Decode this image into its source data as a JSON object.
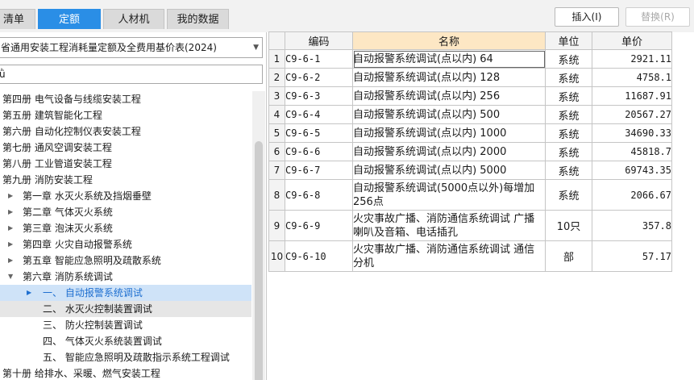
{
  "tabs": [
    {
      "label": "清单",
      "active": false
    },
    {
      "label": "定额",
      "active": true
    },
    {
      "label": "人材机",
      "active": false
    },
    {
      "label": "我的数据",
      "active": false
    }
  ],
  "toolbar": {
    "insert_label": "插入(I)",
    "replace_label": "替换(R)"
  },
  "library": {
    "selected": "省通用安装工程消耗量定额及全费用基价表(2024)"
  },
  "search": {
    "value": "ǜ"
  },
  "tree": [
    {
      "label": "第四册 电气设备与线缆安装工程",
      "level": 0
    },
    {
      "label": "第五册 建筑智能化工程",
      "level": 0
    },
    {
      "label": "第六册 自动化控制仪表安装工程",
      "level": 0
    },
    {
      "label": "第七册 通风空调安装工程",
      "level": 0
    },
    {
      "label": "第八册 工业管道安装工程",
      "level": 0
    },
    {
      "label": "第九册 消防安装工程",
      "level": 0
    },
    {
      "label": "第一章 水灭火系统及挡烟垂壁",
      "level": 1,
      "arrow": "collapsed"
    },
    {
      "label": "第二章 气体灭火系统",
      "level": 1,
      "arrow": "collapsed"
    },
    {
      "label": "第三章 泡沫灭火系统",
      "level": 1,
      "arrow": "collapsed"
    },
    {
      "label": "第四章 火灾自动报警系统",
      "level": 1,
      "arrow": "collapsed"
    },
    {
      "label": "第五章 智能应急照明及疏散系统",
      "level": 1,
      "arrow": "collapsed"
    },
    {
      "label": "第六章 消防系统调试",
      "level": 1,
      "arrow": "expanded"
    },
    {
      "label": "一、 自动报警系统调试",
      "level": 2,
      "arrow": "collapsed",
      "state": "selected"
    },
    {
      "label": "二、 水灭火控制装置调试",
      "level": 2,
      "state": "hover"
    },
    {
      "label": "三、 防火控制装置调试",
      "level": 2
    },
    {
      "label": "四、 气体灭火系统装置调试",
      "level": 2
    },
    {
      "label": "五、 智能应急照明及疏散指示系统工程调试",
      "level": 2
    },
    {
      "label": "第十册 给排水、采暖、燃气安装工程",
      "level": 0
    }
  ],
  "table": {
    "columns": [
      "",
      "编码",
      "名称",
      "单位",
      "单价"
    ],
    "rows": [
      {
        "idx": "1",
        "code": "C9-6-1",
        "name": "自动报警系统调试(点以内) 64",
        "unit": "系统",
        "price": "2921.11"
      },
      {
        "idx": "2",
        "code": "C9-6-2",
        "name": "自动报警系统调试(点以内) 128",
        "unit": "系统",
        "price": "4758.1"
      },
      {
        "idx": "3",
        "code": "C9-6-3",
        "name": "自动报警系统调试(点以内) 256",
        "unit": "系统",
        "price": "11687.91"
      },
      {
        "idx": "4",
        "code": "C9-6-4",
        "name": "自动报警系统调试(点以内) 500",
        "unit": "系统",
        "price": "20567.27"
      },
      {
        "idx": "5",
        "code": "C9-6-5",
        "name": "自动报警系统调试(点以内) 1000",
        "unit": "系统",
        "price": "34690.33"
      },
      {
        "idx": "6",
        "code": "C9-6-6",
        "name": "自动报警系统调试(点以内) 2000",
        "unit": "系统",
        "price": "45818.7"
      },
      {
        "idx": "7",
        "code": "C9-6-7",
        "name": "自动报警系统调试(点以内) 5000",
        "unit": "系统",
        "price": "69743.35"
      },
      {
        "idx": "8",
        "code": "C9-6-8",
        "name": "自动报警系统调试(5000点以外)每增加256点",
        "unit": "系统",
        "price": "2066.67"
      },
      {
        "idx": "9",
        "code": "C9-6-9",
        "name": "火灾事故广播、消防通信系统调试 广播喇叭及音箱、电话插孔",
        "unit": "10只",
        "price": "357.8"
      },
      {
        "idx": "10",
        "code": "C9-6-10",
        "name": "火灾事故广播、消防通信系统调试 通信分机",
        "unit": "部",
        "price": "57.17"
      }
    ]
  }
}
